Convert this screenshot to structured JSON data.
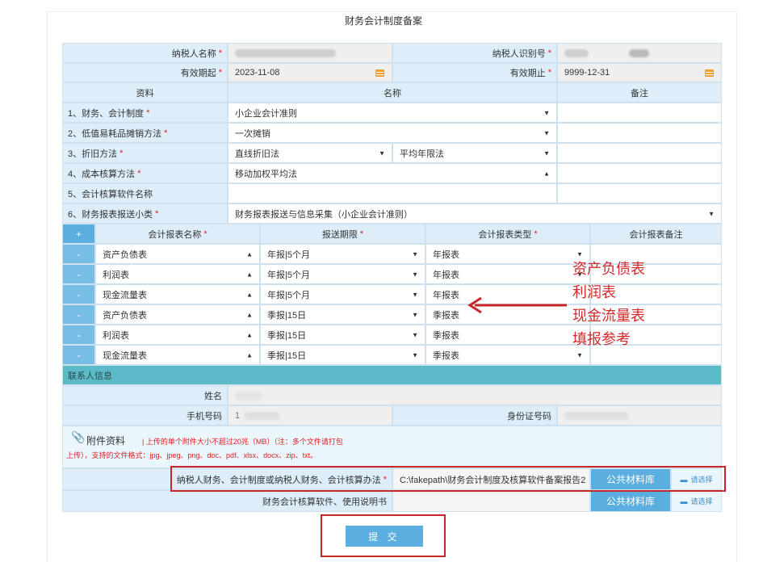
{
  "page_title": "财务会计制度备案",
  "taxpayer": {
    "name_label": "纳税人名称",
    "id_label": "纳税人识别号",
    "start_label": "有效期起",
    "start_value": "2023-11-08",
    "end_label": "有效期止",
    "end_value": "9999-12-31"
  },
  "headers": {
    "material": "资料",
    "name": "名称",
    "remark": "备注"
  },
  "rows": [
    {
      "label": "1、财务、会计制度",
      "required": true,
      "value": "小企业会计准则"
    },
    {
      "label": "2、低值易耗品摊销方法",
      "required": true,
      "value": "一次摊销"
    },
    {
      "label": "3、折旧方法",
      "required": true,
      "value": "直线折旧法",
      "value2": "平均年限法"
    },
    {
      "label": "4、成本核算方法",
      "required": true,
      "value": "移动加权平均法"
    },
    {
      "label": "5、会计核算软件名称",
      "required": false,
      "value": ""
    },
    {
      "label": "6、财务报表报送小类",
      "required": true,
      "value": "财务报表报送与信息采集（小企业会计准则）"
    }
  ],
  "report_table": {
    "add": "+",
    "minus": "-",
    "col_name": "会计报表名称",
    "col_deadline": "报送期限",
    "col_type": "会计报表类型",
    "col_remark": "会计报表备注",
    "rows": [
      {
        "name": "资产负债表",
        "deadline": "年报|5个月",
        "type": "年报表"
      },
      {
        "name": "利润表",
        "deadline": "年报|5个月",
        "type": "年报表"
      },
      {
        "name": "现金流量表",
        "deadline": "年报|5个月",
        "type": "年报表"
      },
      {
        "name": "资产负债表",
        "deadline": "季报|15日",
        "type": "季报表"
      },
      {
        "name": "利润表",
        "deadline": "季报|15日",
        "type": "季报表"
      },
      {
        "name": "现金流量表",
        "deadline": "季报|15日",
        "type": "季报表"
      }
    ]
  },
  "contact": {
    "section": "联系人信息",
    "name_label": "姓名",
    "phone_label": "手机号码",
    "phone_prefix": "1",
    "id_label": "身份证号码"
  },
  "attachment": {
    "title": "附件资料",
    "note_line1": "| 上传的单个附件大小不超过20兆（MB）（注：多个文件请打包",
    "note_line2": "上传），支持的文件格式：jpg、jpeg、png、doc、pdf、xlsx、docx、zip、txt。",
    "row1_label": "纳税人财务、会计制度或纳税人财务、会计核算办法",
    "row1_value": "C:\\fakepath\\财务会计制度及核算软件备案报告2",
    "row2_label": "财务会计核算软件、使用说明书",
    "public_lib": "公共材料库",
    "choose": "请选择"
  },
  "annotation": [
    "资产负债表",
    "利润表",
    "现金流量表",
    "填报参考"
  ],
  "submit": "提 交",
  "colors": {
    "label_bg": "#ddeefa",
    "button_blue": "#5aaee0",
    "teal": "#5bbac6",
    "highlight_red": "#c62828"
  }
}
